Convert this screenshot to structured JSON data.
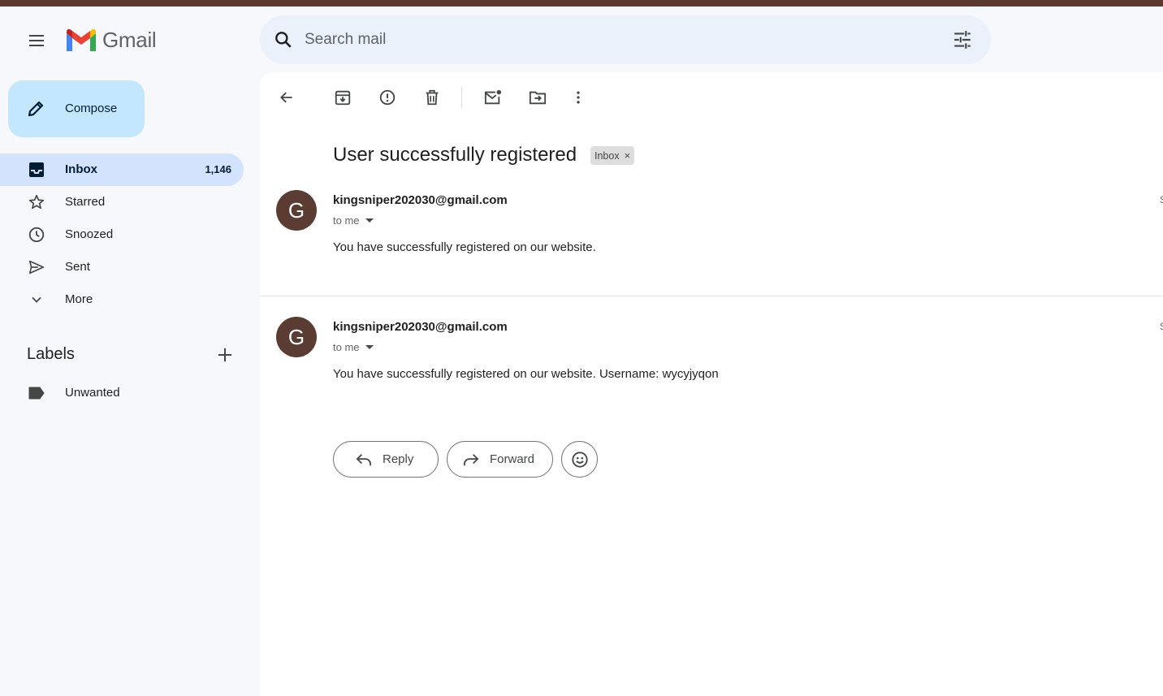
{
  "app": {
    "name": "Gmail"
  },
  "search": {
    "placeholder": "Search mail"
  },
  "compose": {
    "label": "Compose"
  },
  "sidebar": {
    "items": [
      {
        "label": "Inbox",
        "count": "1,146",
        "icon": "inbox-icon",
        "active": true
      },
      {
        "label": "Starred",
        "icon": "star-icon"
      },
      {
        "label": "Snoozed",
        "icon": "clock-icon"
      },
      {
        "label": "Sent",
        "icon": "send-icon"
      },
      {
        "label": "More",
        "icon": "chevron-down-icon"
      }
    ],
    "labels_title": "Labels",
    "labels": [
      {
        "label": "Unwanted",
        "icon": "label-icon"
      }
    ]
  },
  "thread": {
    "subject": "User successfully registered",
    "chip": "Inbox",
    "messages": [
      {
        "avatar": "G",
        "sender": "kingsniper202030@gmail.com",
        "to": "to me",
        "body": "You have successfully registered on our website.",
        "edge": "S"
      },
      {
        "avatar": "G",
        "sender": "kingsniper202030@gmail.com",
        "to": "to me",
        "body": "You have successfully registered on our website. Username: wycyjyqon",
        "edge": "S"
      }
    ],
    "actions": {
      "reply": "Reply",
      "forward": "Forward"
    }
  },
  "colors": {
    "accent": "#c2e7ff",
    "active_nav": "#d3e3fd",
    "avatar": "#5b3c32",
    "background": "#f6f8fc"
  }
}
